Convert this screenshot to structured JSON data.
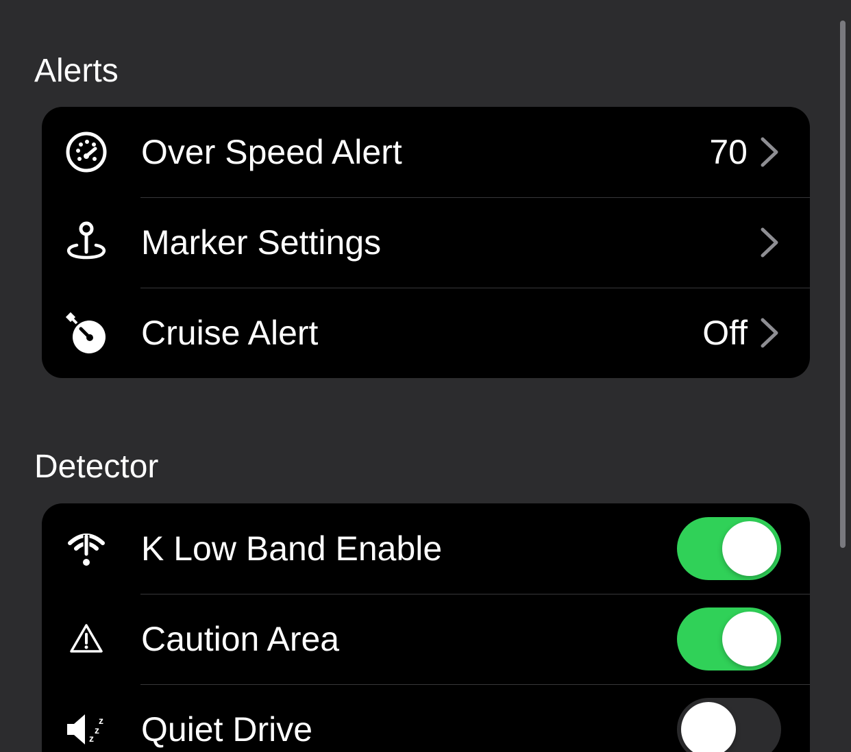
{
  "sections": [
    {
      "header": "Alerts",
      "rows": [
        {
          "label": "Over Speed Alert",
          "value": "70",
          "icon": "speedometer-icon"
        },
        {
          "label": "Marker Settings",
          "value": "",
          "icon": "location-pin-icon"
        },
        {
          "label": "Cruise Alert",
          "value": "Off",
          "icon": "timer-icon"
        }
      ]
    },
    {
      "header": "Detector",
      "rows": [
        {
          "label": "K Low Band Enable",
          "toggle": true,
          "icon": "antenna-signal-icon"
        },
        {
          "label": "Caution Area",
          "toggle": true,
          "icon": "warning-triangle-icon"
        },
        {
          "label": "Quiet Drive",
          "toggle": false,
          "icon": "speaker-zzz-icon"
        }
      ]
    }
  ],
  "colors": {
    "background": "#2c2c2e",
    "group_background": "#000000",
    "toggle_on": "#30d158",
    "separator": "#38383a",
    "chevron": "#8e8e93"
  }
}
